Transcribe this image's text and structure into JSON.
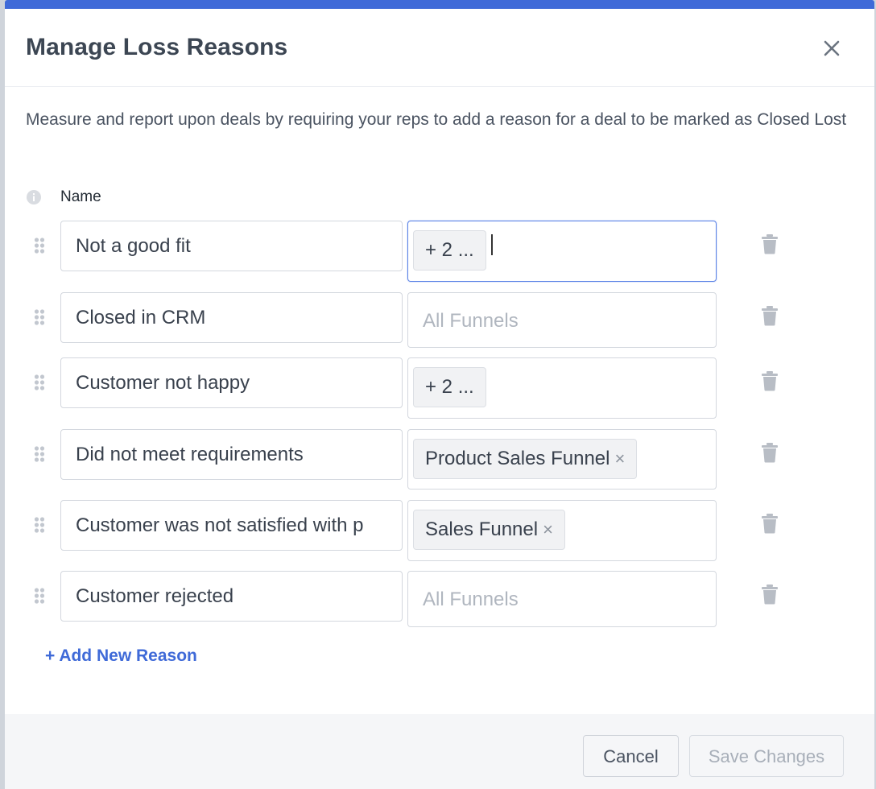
{
  "modal": {
    "title": "Manage Loss Reasons",
    "description": "Measure and report upon deals by requiring your reps to add a reason for a deal to be marked as Closed Lost",
    "name_column_label": "Name",
    "add_reason_label": "+ Add New Reason",
    "cancel_label": "Cancel",
    "save_label": "Save Changes"
  },
  "reasons": [
    {
      "name": "Not a good fit",
      "funnel": {
        "kind": "chip",
        "text": "+ 2 ...",
        "removable": false,
        "focused": true
      }
    },
    {
      "name": "Closed in CRM",
      "funnel": {
        "kind": "placeholder",
        "text": "All Funnels"
      }
    },
    {
      "name": "Customer not happy",
      "funnel": {
        "kind": "chip",
        "text": "+ 2 ...",
        "removable": false
      }
    },
    {
      "name": "Did not meet requirements",
      "funnel": {
        "kind": "chip",
        "text": "Product Sales Funnel",
        "removable": true
      }
    },
    {
      "name": "Customer was not satisfied with p",
      "funnel": {
        "kind": "chip",
        "text": "Sales Funnel",
        "removable": true
      }
    },
    {
      "name": "Customer rejected",
      "funnel": {
        "kind": "placeholder",
        "text": "All Funnels"
      }
    }
  ],
  "icons": {
    "close": "close-icon",
    "info": "info-icon",
    "drag": "drag-handle-icon",
    "delete": "trash-icon",
    "chip_remove": "×"
  },
  "colors": {
    "accent": "#3f6ad8",
    "title": "#3c4653",
    "focus_border": "#5b83e6",
    "footer_bg": "#f5f6f8"
  }
}
